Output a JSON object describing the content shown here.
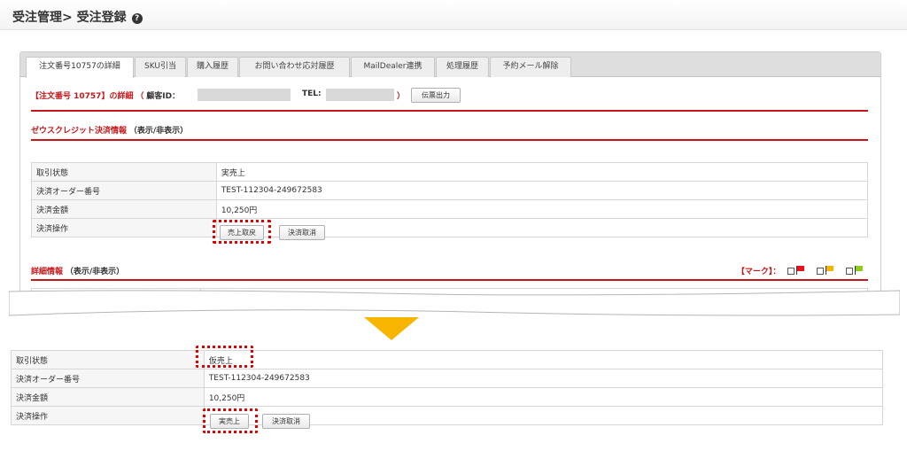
{
  "header": {
    "title": "受注管理> 受注登録",
    "help_icon": "question-circle-icon"
  },
  "tabs": [
    "注文番号10757の詳細",
    "SKU引当",
    "購入履歴",
    "お問い合わせ応対履歴",
    "MailDealer連携",
    "処理履歴",
    "予約メール解除"
  ],
  "order": {
    "title": "【注文番号 10757】の詳細",
    "customer_prefix": "（",
    "customer_label": "顧客ID：",
    "tel_label": "TEL:",
    "close_paren": "）",
    "slip_button": "伝票出力"
  },
  "zeus_section": {
    "title": "ゼウスクレジット決済情報",
    "toggle": "（表示/非表示）"
  },
  "payment_before": {
    "rows": [
      {
        "label": "取引状態",
        "value": "実売上"
      },
      {
        "label": "決済オーダー番号",
        "value": "TEST-112304-249672583"
      },
      {
        "label": "決済金額",
        "value": "10,250円"
      },
      {
        "label": "決済操作",
        "value": ""
      }
    ],
    "primary_button": "売上取戻",
    "cancel_button": "決済取消"
  },
  "detail_section": {
    "title": "詳細情報",
    "toggle": "（表示/非表示）",
    "mark_label": "【マーク】："
  },
  "mark_colors": [
    "#e8141c",
    "#f5b400",
    "#8ccc1e"
  ],
  "payment_after": {
    "rows": [
      {
        "label": "取引状態",
        "value": "仮売上"
      },
      {
        "label": "決済オーダー番号",
        "value": "TEST-112304-249672583"
      },
      {
        "label": "決済金額",
        "value": "10,250円"
      },
      {
        "label": "決済操作",
        "value": ""
      }
    ],
    "primary_button": "実売上",
    "cancel_button": "決済取消"
  },
  "accent_color": "#c6161a",
  "highlight_color": "#e00000",
  "arrow_color": "#f7b500"
}
